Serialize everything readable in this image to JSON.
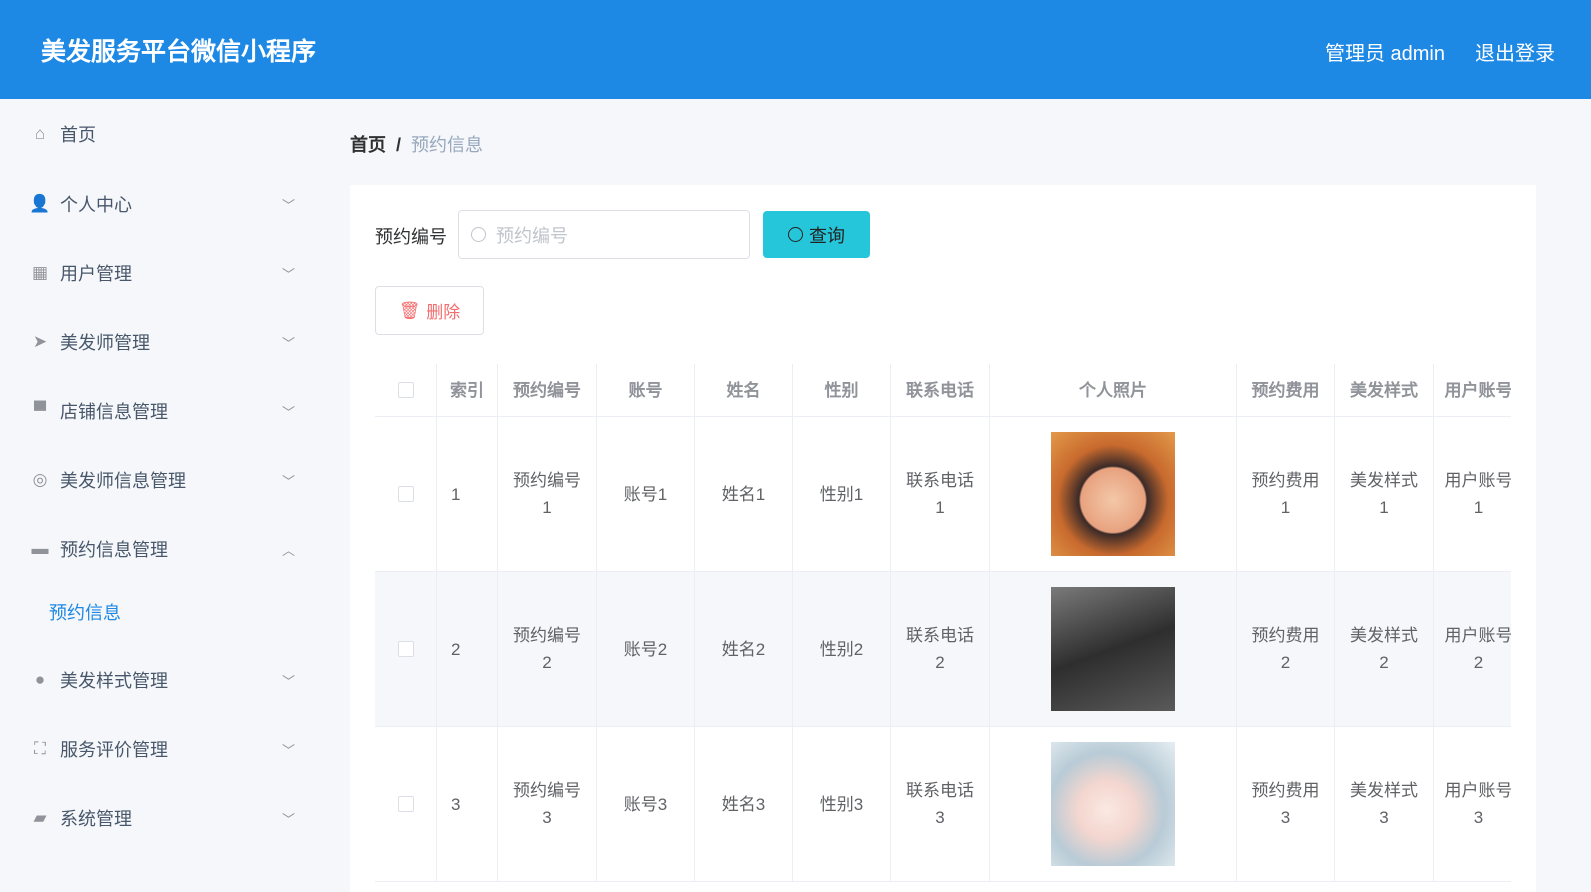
{
  "header": {
    "title": "美发服务平台微信小程序",
    "user": "管理员 admin",
    "logout": "退出登录"
  },
  "sidebar": {
    "items": [
      {
        "label": "首页",
        "icon": "home-icon"
      },
      {
        "label": "个人中心",
        "icon": "user-icon"
      },
      {
        "label": "用户管理",
        "icon": "grid-icon"
      },
      {
        "label": "美发师管理",
        "icon": "send-icon"
      },
      {
        "label": "店铺信息管理",
        "icon": "shop-icon"
      },
      {
        "label": "美发师信息管理",
        "icon": "lifebuoy-icon"
      },
      {
        "label": "预约信息管理",
        "icon": "monitor-icon"
      },
      {
        "label": "美发样式管理",
        "icon": "bulb-icon"
      },
      {
        "label": "服务评价管理",
        "icon": "fullscreen-icon"
      },
      {
        "label": "系统管理",
        "icon": "wallet-icon"
      }
    ],
    "sub_active": "预约信息"
  },
  "breadcrumb": {
    "home": "首页",
    "sep": "/",
    "current": "预约信息"
  },
  "search": {
    "label": "预约编号",
    "placeholder": "预约编号",
    "button": "查询"
  },
  "actions": {
    "delete": "删除"
  },
  "table": {
    "headers": [
      "索引",
      "预约编号",
      "账号",
      "姓名",
      "性别",
      "联系电话",
      "个人照片",
      "预约费用",
      "美发样式",
      "用户账号"
    ],
    "rows": [
      [
        "1",
        "预约编号\n1",
        "账号1",
        "姓名1",
        "性别1",
        "联系电话\n1",
        "",
        "预约费用\n1",
        "美发样式\n1",
        "用户账号\n1"
      ],
      [
        "2",
        "预约编号\n2",
        "账号2",
        "姓名2",
        "性别2",
        "联系电话\n2",
        "",
        "预约费用\n2",
        "美发样式\n2",
        "用户账号\n2"
      ],
      [
        "3",
        "预约编号\n3",
        "账号3",
        "姓名3",
        "性别3",
        "联系电话\n3",
        "",
        "预约费用\n3",
        "美发样式\n3",
        "用户账号\n3"
      ]
    ]
  },
  "colors": {
    "primary": "#1e88e5",
    "query": "#26c6da",
    "danger": "#f56c6c"
  }
}
